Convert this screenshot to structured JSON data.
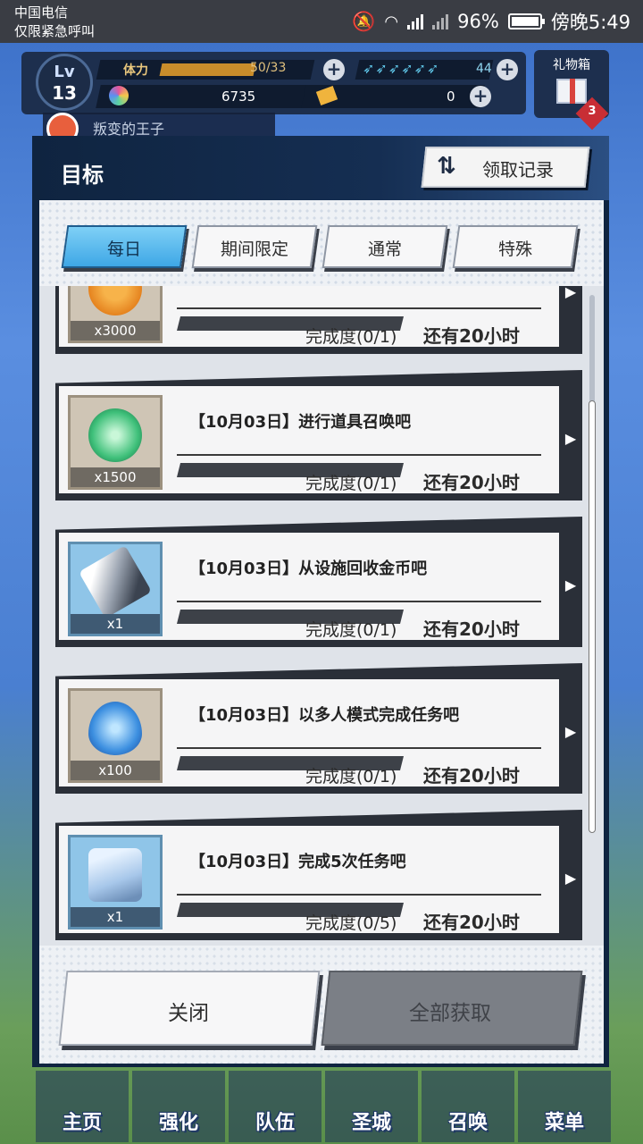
{
  "status_bar": {
    "carrier": "中国电信",
    "carrier_note": "仅限紧急呼叫",
    "battery": "96%",
    "time": "傍晚5:49"
  },
  "hud": {
    "level_label": "Lv",
    "level": "13",
    "stamina_label": "体力",
    "stamina_value": "50/33",
    "feather_value": "44",
    "gems": "6735",
    "tickets": "0",
    "gift_label": "礼物箱",
    "gift_badge": "3",
    "quest_tag": "叛变的王子"
  },
  "modal": {
    "title": "目标",
    "history_label": "领取记录",
    "tabs": [
      {
        "label": "每日",
        "active": true
      },
      {
        "label": "期间限定",
        "active": false
      },
      {
        "label": "通常",
        "active": false
      },
      {
        "label": "特殊",
        "active": false
      }
    ],
    "missions": [
      {
        "title": "",
        "reward_count": "x3000",
        "progress": "完成度(0/1)",
        "time_left": "还有20小时"
      },
      {
        "title": "【10月03日】进行道具召唤吧",
        "reward_count": "x1500",
        "progress": "完成度(0/1)",
        "time_left": "还有20小时"
      },
      {
        "title": "【10月03日】从设施回收金币吧",
        "reward_count": "x1",
        "progress": "完成度(0/1)",
        "time_left": "还有20小时"
      },
      {
        "title": "【10月03日】以多人模式完成任务吧",
        "reward_count": "x100",
        "progress": "完成度(0/1)",
        "time_left": "还有20小时"
      },
      {
        "title": "【10月03日】完成5次任务吧",
        "reward_count": "x1",
        "progress": "完成度(0/5)",
        "time_left": "还有20小时"
      }
    ],
    "close_label": "关闭",
    "claim_all_label": "全部获取"
  },
  "bottom_nav": [
    {
      "label": "主页"
    },
    {
      "label": "强化"
    },
    {
      "label": "队伍"
    },
    {
      "label": "圣城"
    },
    {
      "label": "召唤"
    },
    {
      "label": "菜单"
    }
  ]
}
